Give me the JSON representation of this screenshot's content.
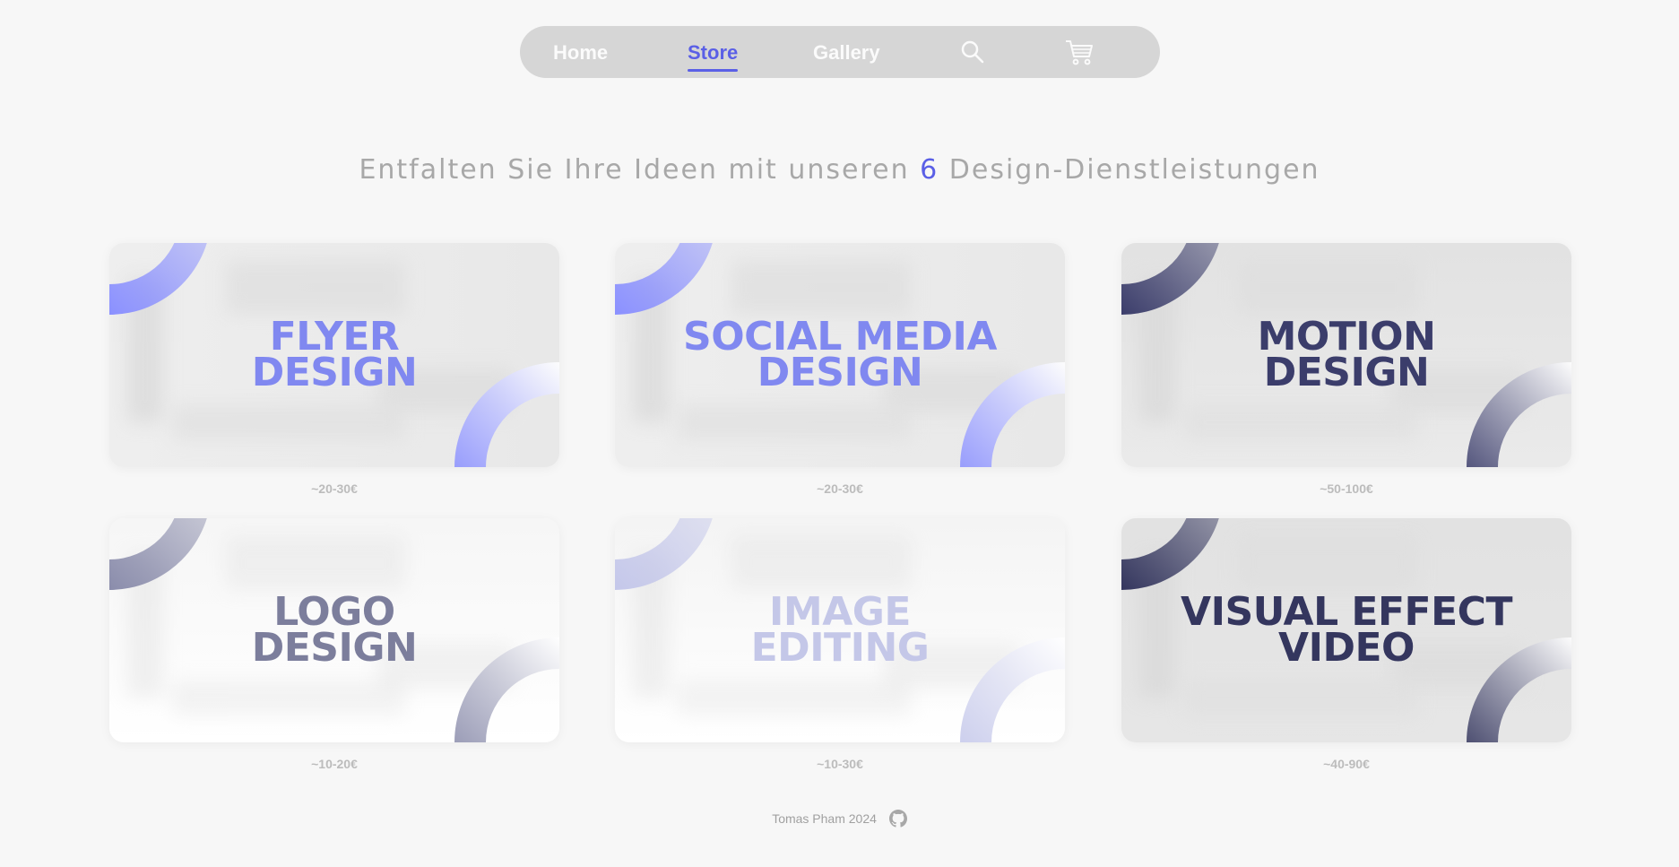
{
  "nav": {
    "items": [
      {
        "label": "Home",
        "active": false
      },
      {
        "label": "Store",
        "active": true
      },
      {
        "label": "Gallery",
        "active": false
      }
    ],
    "icons": [
      "search-icon",
      "cart-icon"
    ]
  },
  "headline": {
    "before": "Entfalten Sie Ihre Ideen mit unseren ",
    "count": "6",
    "after": " Design-Dienstleistungen"
  },
  "services": [
    {
      "title_line1": "FLYER",
      "title_line2": "DESIGN",
      "price": "~20-30€",
      "color": "#8088f0",
      "corner_color": "#8a90ff"
    },
    {
      "title_line1": "SOCIAL MEDIA",
      "title_line2": "DESIGN",
      "price": "~20-30€",
      "color": "#8088f0",
      "corner_color": "#8a90ff"
    },
    {
      "title_line1": "MOTION",
      "title_line2": "DESIGN",
      "price": "~50-100€",
      "color": "#3b3d6b",
      "corner_color": "#3b3d6b"
    },
    {
      "title_line1": "LOGO",
      "title_line2": "DESIGN",
      "price": "~10-20€",
      "color": "#7c7e9c",
      "corner_color": "#8a8cab"
    },
    {
      "title_line1": "IMAGE",
      "title_line2": "EDITING",
      "price": "~10-30€",
      "color": "#c4c7e8",
      "corner_color": "#c4c7ea"
    },
    {
      "title_line1": "VISUAL EFFECT",
      "title_line2": "VIDEO",
      "price": "~40-90€",
      "color": "#34365e",
      "corner_color": "#34365e"
    }
  ],
  "footer": {
    "text": "Tomas Pham 2024",
    "icon": "github-icon"
  },
  "colors": {
    "accent": "#5a5fe6",
    "nav_bg": "#d6d6d6",
    "page_bg": "#f7f7f7"
  }
}
